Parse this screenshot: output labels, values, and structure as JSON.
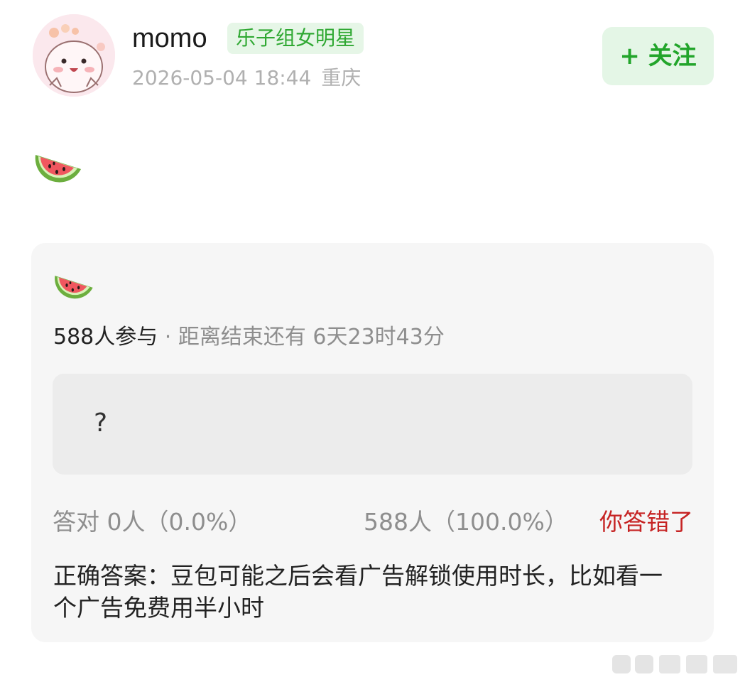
{
  "post": {
    "author": "momo",
    "badge": "乐子组女明星",
    "timestamp": "2026-05-04 18:44",
    "location": "重庆",
    "follow_label": "+ 关注",
    "emoji": "watermelon"
  },
  "quiz": {
    "emoji": "watermelon",
    "participants": "588人参与",
    "separator": " · ",
    "time_left": "距离结束还有 6天23时43分",
    "option_text": "?",
    "correct_count": "答对  0人（0.0%）",
    "other_count": "588人（100.0%）",
    "result_status": "你答错了",
    "answer_text": "正确答案：豆包可能之后会看广告解锁使用时长，比如看一个广告免费用半小时"
  },
  "colors": {
    "accent_green": "#22a52b",
    "badge_green": "#2fa832",
    "wrong_red": "#c62323"
  }
}
